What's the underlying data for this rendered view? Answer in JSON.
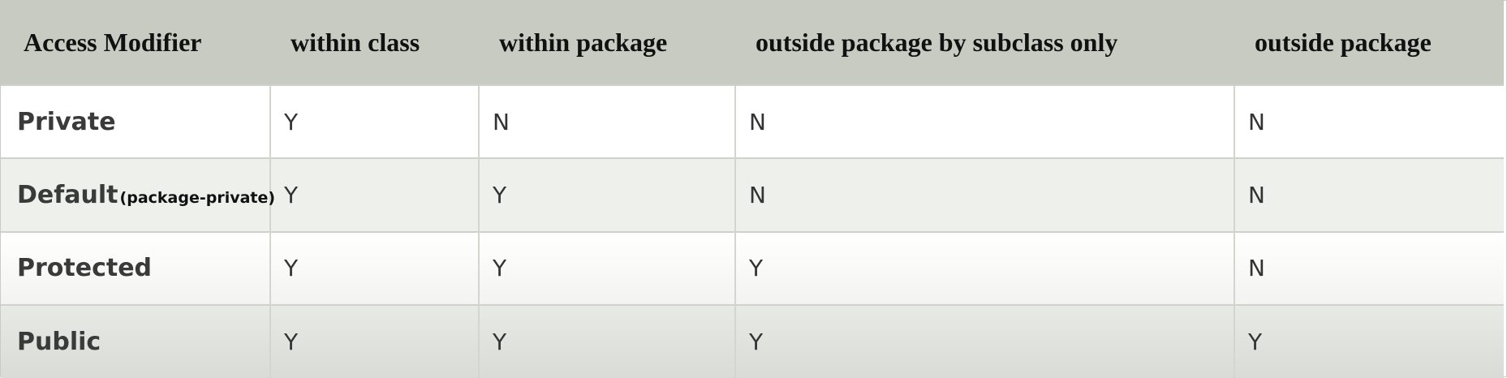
{
  "table": {
    "headers": [
      "Access Modifier",
      "within class",
      "within package",
      "outside package by subclass only",
      "outside package"
    ],
    "rows": [
      {
        "modifier": "Private",
        "note": "",
        "cells": [
          "Y",
          "N",
          "N",
          "N"
        ]
      },
      {
        "modifier": "Default",
        "note": "(package-private)",
        "cells": [
          "Y",
          "Y",
          "N",
          "N"
        ]
      },
      {
        "modifier": "Protected",
        "note": "",
        "cells": [
          "Y",
          "Y",
          "Y",
          "N"
        ]
      },
      {
        "modifier": "Public",
        "note": "",
        "cells": [
          "Y",
          "Y",
          "Y",
          "Y"
        ]
      }
    ]
  },
  "colors": {
    "header_bg": "#c8cbc2",
    "row_alt_bg": "#eef0eb",
    "border": "#cfd2cb"
  }
}
